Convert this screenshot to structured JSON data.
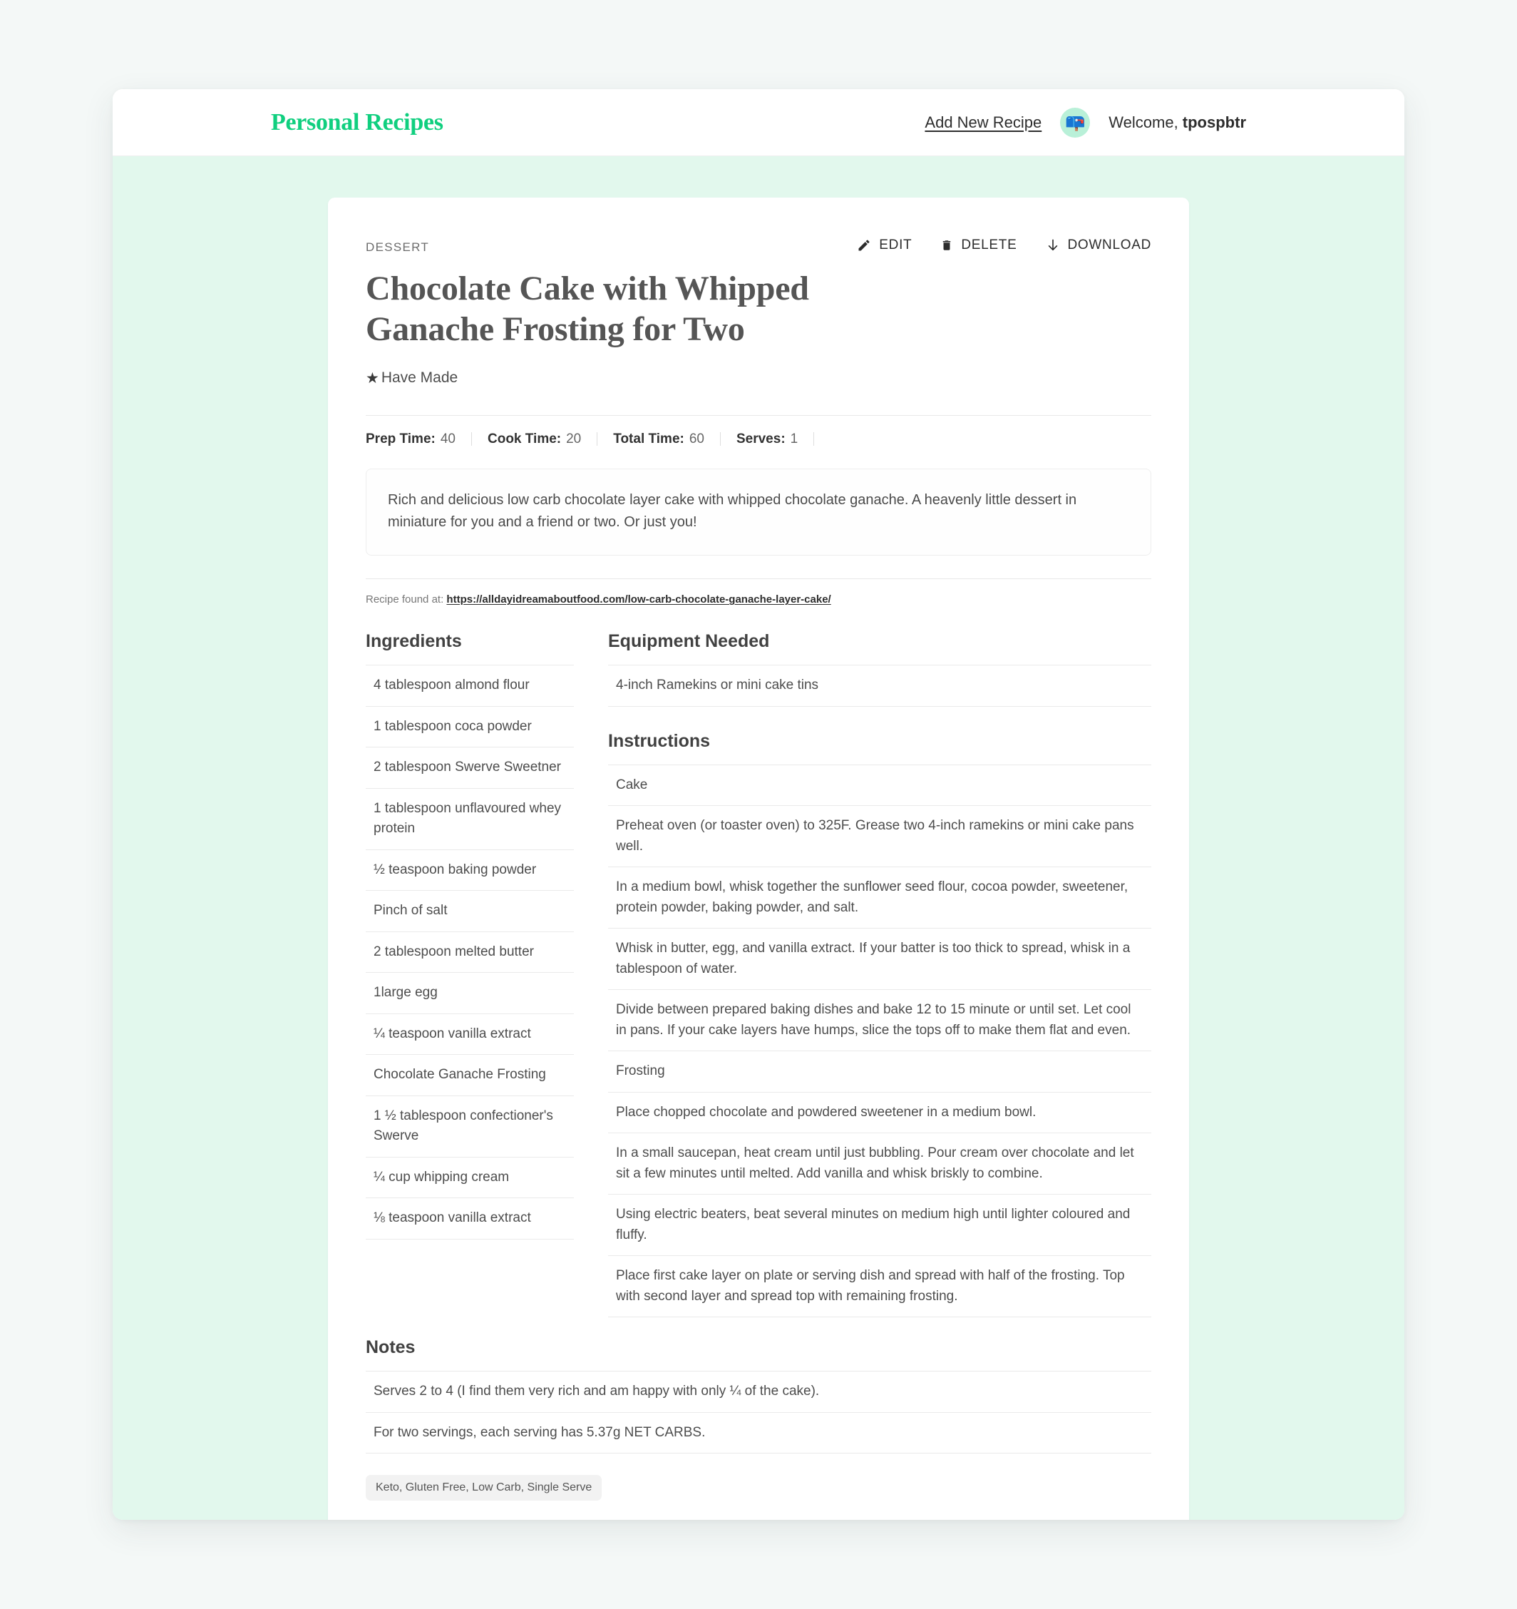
{
  "header": {
    "brand": "Personal Recipes",
    "add_new_recipe": "Add New Recipe",
    "avatar_icon": "mailbox-emoji",
    "avatar_glyph": "📪",
    "welcome_prefix": "Welcome, ",
    "username": "tpospbtr",
    "brand_color": "#10cf7f"
  },
  "recipe": {
    "category": "DESSERT",
    "title": "Chocolate Cake with Whipped Ganache Frosting for Two",
    "have_made_label": "Have Made",
    "have_made_icon": "star-filled-icon",
    "actions": [
      {
        "label": "EDIT",
        "icon": "pencil-icon"
      },
      {
        "label": "DELETE",
        "icon": "trash-icon"
      },
      {
        "label": "DOWNLOAD",
        "icon": "download-arrow-icon"
      }
    ],
    "meta": [
      {
        "label": "Prep Time:",
        "value": "40"
      },
      {
        "label": "Cook Time:",
        "value": "20"
      },
      {
        "label": "Total Time:",
        "value": "60"
      },
      {
        "label": "Serves:",
        "value": "1"
      }
    ],
    "description": "Rich and delicious low carb chocolate layer cake with whipped chocolate ganache. A heavenly little dessert in miniature for you and a friend or two. Or just you!",
    "source_prefix": "Recipe found at:",
    "source_url": "https://alldayidreamaboutfood.com/low-carb-chocolate-ganache-layer-cake/",
    "ingredients_heading": "Ingredients",
    "ingredients": [
      "4 tablespoon almond flour",
      "1 tablespoon coca powder",
      "2 tablespoon Swerve Sweetner",
      "1 tablespoon unflavoured whey protein",
      "½ teaspoon baking powder",
      "Pinch of salt",
      "2 tablespoon melted butter",
      "1large egg",
      "¼ teaspoon vanilla extract",
      "Chocolate Ganache Frosting",
      "1 ½ tablespoon confectioner's Swerve",
      "¼ cup whipping cream",
      "⅛ teaspoon vanilla extract"
    ],
    "equipment_heading": "Equipment Needed",
    "equipment": [
      "4-inch Ramekins or mini cake tins"
    ],
    "instructions_heading": "Instructions",
    "instructions": [
      "Cake",
      "Preheat oven (or toaster oven) to 325F. Grease two 4-inch ramekins or mini cake pans well.",
      "In a medium bowl, whisk together the sunflower seed flour, cocoa powder, sweetener, protein powder, baking powder, and salt.",
      "Whisk in butter, egg, and vanilla extract. If your batter is too thick to spread, whisk in a tablespoon of water.",
      "Divide between prepared baking dishes and bake 12 to 15 minute or until set. Let cool in pans. If your cake layers have humps, slice the tops off to make them flat and even.",
      "Frosting",
      "Place chopped chocolate and powdered sweetener in a medium bowl.",
      "In a small saucepan, heat cream until just bubbling. Pour cream over chocolate and let sit a few minutes until melted. Add vanilla and whisk briskly to combine.",
      "Using electric beaters, beat several minutes on medium high until lighter coloured and fluffy.",
      "Place first cake layer on plate or serving dish and spread with half of the frosting. Top with second layer and spread top with remaining frosting."
    ],
    "notes_heading": "Notes",
    "notes": [
      "Serves 2 to 4 (I find them very rich and am happy with only ¼ of the cake).",
      "For two servings, each serving has 5.37g NET CARBS."
    ],
    "tags": "Keto, Gluten Free, Low Carb, Single Serve"
  }
}
